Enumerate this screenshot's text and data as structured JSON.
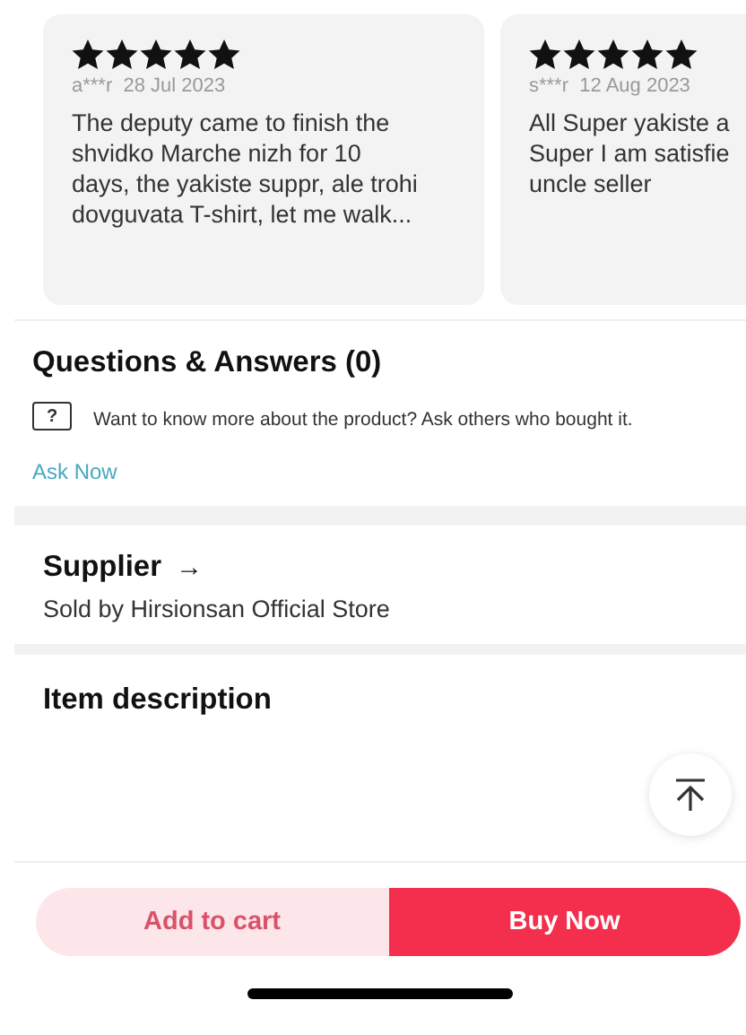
{
  "reviews": [
    {
      "stars": 5,
      "user": "a***r",
      "date": "28 Jul 2023",
      "lines": [
        "The deputy came to finish the",
        "shvidko Marche nizh for 10",
        "days, the yakiste suppr, ale trohi",
        "dovguvata T-shirt, let me walk..."
      ]
    },
    {
      "stars": 5,
      "user": "s***r",
      "date": "12 Aug 2023",
      "lines": [
        "All Super yakiste a",
        "Super I am satisfie",
        "uncle seller"
      ]
    }
  ],
  "questions": {
    "title": "Questions & Answers (0)",
    "icon_text": "?",
    "prompt": "Want to know more about the product? Ask others who bought it.",
    "link": "Ask Now"
  },
  "supplier": {
    "title": "Supplier",
    "arrow": "→",
    "seller": "Sold by Hirsionsan Official Store"
  },
  "description": {
    "title": "Item description"
  },
  "actions": [
    {
      "label": "Add to cart",
      "kind": "secondary"
    },
    {
      "label": "Buy Now",
      "kind": "primary"
    }
  ]
}
